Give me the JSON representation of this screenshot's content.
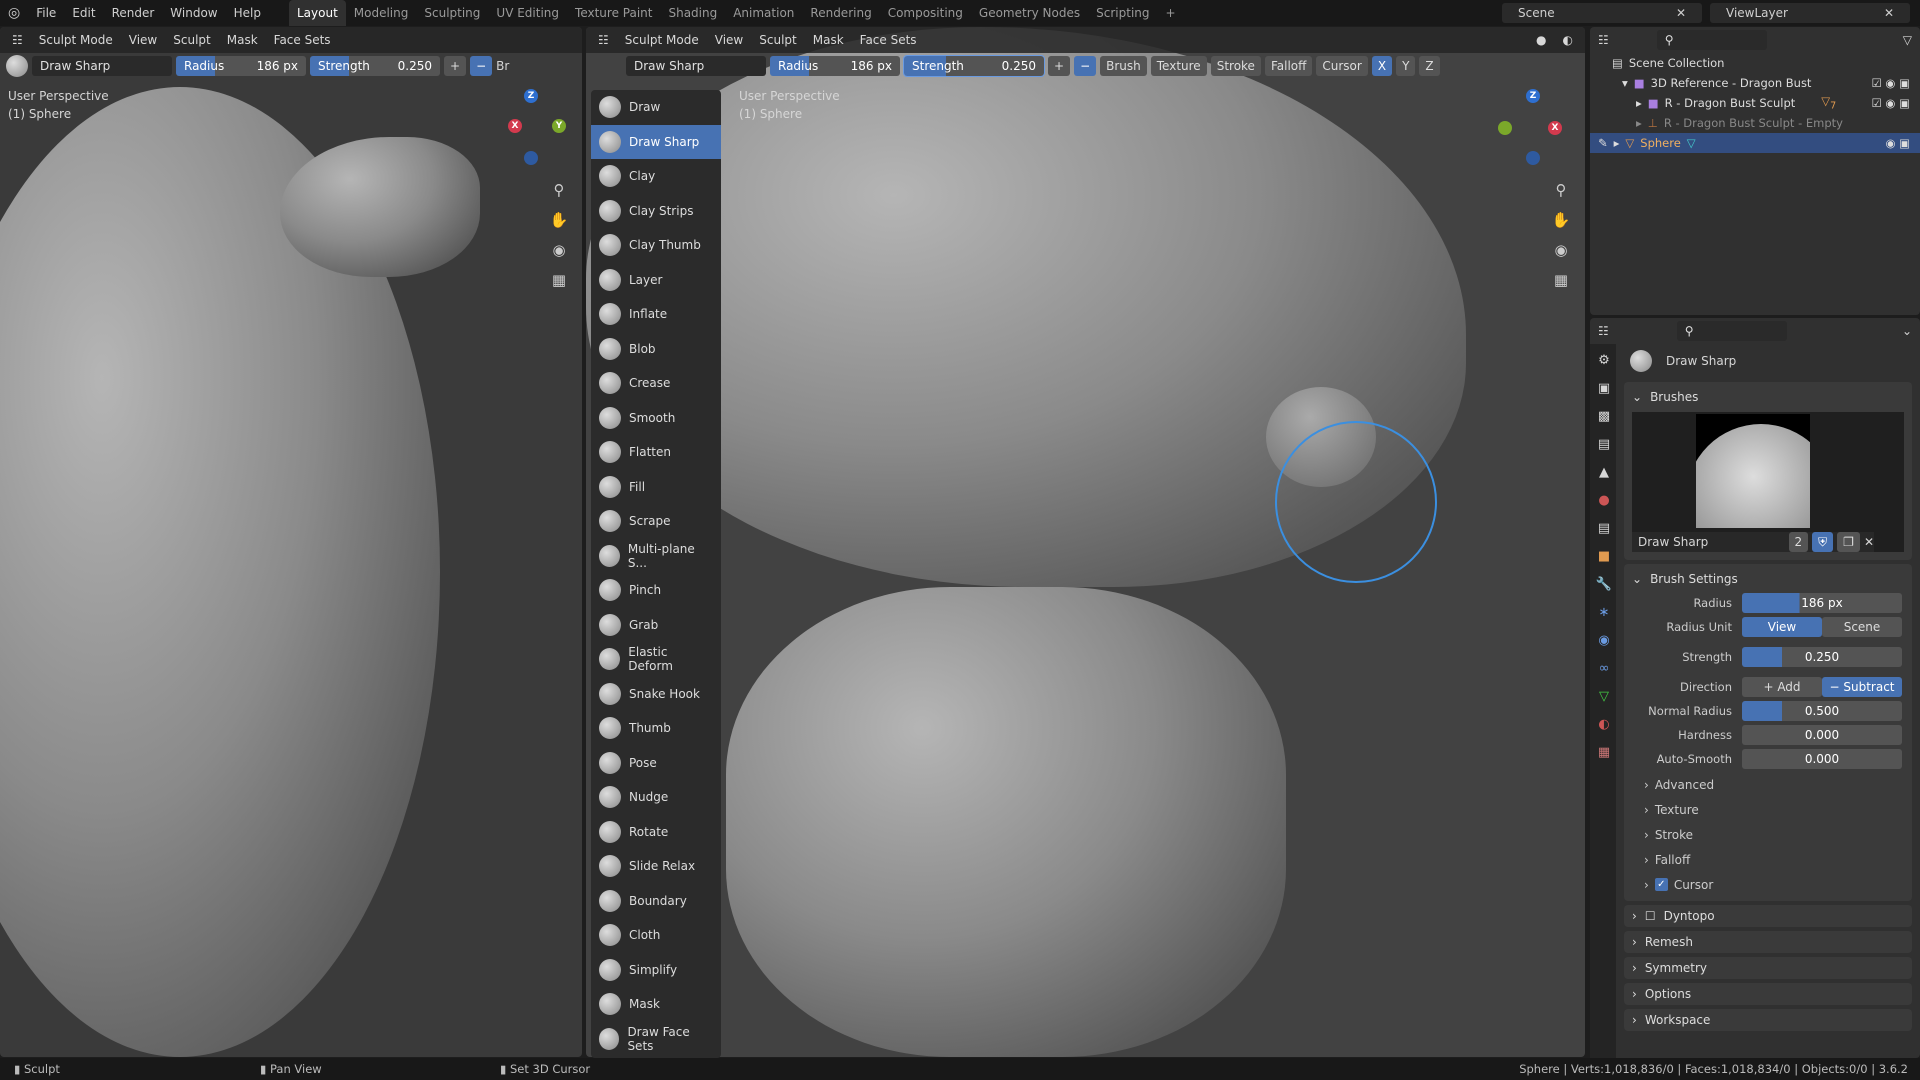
{
  "menu": [
    "File",
    "Edit",
    "Render",
    "Window",
    "Help"
  ],
  "workspaces": [
    "Layout",
    "Modeling",
    "Sculpting",
    "UV Editing",
    "Texture Paint",
    "Shading",
    "Animation",
    "Rendering",
    "Compositing",
    "Geometry Nodes",
    "Scripting"
  ],
  "scene": "Scene",
  "view_layer": "ViewLayer",
  "viewport_header": {
    "mode": "Sculpt Mode",
    "menus": [
      "View",
      "Sculpt",
      "Mask",
      "Face Sets"
    ]
  },
  "tool_settings": {
    "brush": "Draw Sharp",
    "radius_label": "Radius",
    "radius": "186 px",
    "strength_label": "Strength",
    "strength": "0.250",
    "dropdowns": [
      "Brush",
      "Texture",
      "Stroke",
      "Falloff",
      "Cursor"
    ],
    "axes": [
      "X",
      "Y",
      "Z"
    ],
    "truncated": "Br"
  },
  "left_view": {
    "perspective": "User Perspective",
    "object": "(1) Sphere"
  },
  "main_view": {
    "perspective": "User Perspective",
    "object": "(1) Sphere"
  },
  "tools": [
    "Draw",
    "Draw Sharp",
    "Clay",
    "Clay Strips",
    "Clay Thumb",
    "Layer",
    "Inflate",
    "Blob",
    "Crease",
    "Smooth",
    "Flatten",
    "Fill",
    "Scrape",
    "Multi-plane S...",
    "Pinch",
    "Grab",
    "Elastic Deform",
    "Snake Hook",
    "Thumb",
    "Pose",
    "Nudge",
    "Rotate",
    "Slide Relax",
    "Boundary",
    "Cloth",
    "Simplify",
    "Mask",
    "Draw Face Sets"
  ],
  "active_tool": "Draw Sharp",
  "outliner": {
    "root": "Scene Collection",
    "items": [
      {
        "name": "3D Reference - Dragon Bust"
      },
      {
        "name": "R - Dragon Bust Sculpt",
        "badge": "7"
      },
      {
        "name": "R - Dragon Bust Sculpt - Empty"
      },
      {
        "name": "Sphere",
        "selected": true
      }
    ]
  },
  "properties": {
    "title": "Draw Sharp",
    "brushes_label": "Brushes",
    "brush_name": "Draw Sharp",
    "users": "2",
    "brush_settings_label": "Brush Settings",
    "rows": {
      "radius_label": "Radius",
      "radius": "186 px",
      "radius_unit_label": "Radius Unit",
      "unit_view": "View",
      "unit_scene": "Scene",
      "strength_label": "Strength",
      "strength": "0.250",
      "direction_label": "Direction",
      "add": "Add",
      "subtract": "Subtract",
      "normal_radius_label": "Normal Radius",
      "normal_radius": "0.500",
      "hardness_label": "Hardness",
      "hardness": "0.000",
      "autosmooth_label": "Auto-Smooth",
      "autosmooth": "0.000"
    },
    "subpanels": [
      "Advanced",
      "Texture",
      "Stroke",
      "Falloff",
      "Cursor"
    ],
    "panels": [
      "Dyntopo",
      "Remesh",
      "Symmetry",
      "Options",
      "Workspace"
    ]
  },
  "status": {
    "left": "Sculpt",
    "middle": "Pan View",
    "right": "Set 3D Cursor",
    "stats": "Sphere | Verts:1,018,836/0 | Faces:1,018,834/0 | Objects:0/0 | 3.6.2"
  },
  "colors": {
    "accent": "#4772b3",
    "brush_circle": "#3b8fe0"
  }
}
